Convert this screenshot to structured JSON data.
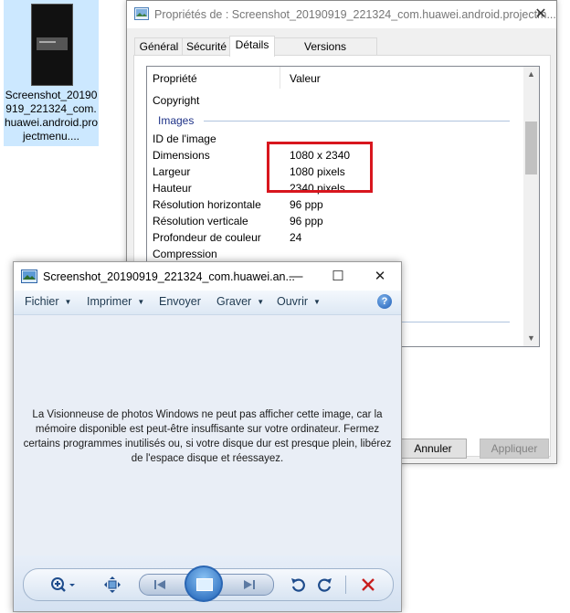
{
  "desktop_file": {
    "name": "Screenshot_20190919_221324_com.huawei.android.projectmenu...."
  },
  "properties_window": {
    "title": "Propriétés de : Screenshot_20190919_221324_com.huawei.android.projectm...",
    "close_glyph": "✕",
    "tabs": [
      "Général",
      "Sécurité",
      "Détails",
      "Versions précédentes"
    ],
    "active_tab": "Détails",
    "columns": {
      "property": "Propriété",
      "value": "Valeur"
    },
    "section_images": "Images",
    "rows": [
      {
        "label": "Copyright",
        "value": ""
      },
      {
        "label": "ID de l'image",
        "value": ""
      },
      {
        "label": "Dimensions",
        "value": "1080 x 2340"
      },
      {
        "label": "Largeur",
        "value": "1080 pixels"
      },
      {
        "label": "Hauteur",
        "value": "2340 pixels"
      },
      {
        "label": "Résolution horizontale",
        "value": "96 ppp"
      },
      {
        "label": "Résolution verticale",
        "value": "96 ppp"
      },
      {
        "label": "Profondeur de couleur",
        "value": "24"
      },
      {
        "label": "Compression",
        "value": ""
      }
    ],
    "highlight_color": "#d8161e",
    "buttons": {
      "cancel": "Annuler",
      "apply": "Appliquer"
    }
  },
  "viewer_window": {
    "title": "Screenshot_20190919_221324_com.huawei.an...",
    "window_controls": {
      "minimize": "—",
      "maximize": "☐",
      "close": "✕"
    },
    "menu": [
      {
        "label": "Fichier",
        "arrow": "▼"
      },
      {
        "label": "Imprimer",
        "arrow": "▼"
      },
      {
        "label": "Envoyer",
        "arrow": ""
      },
      {
        "label": "Graver",
        "arrow": "▼"
      },
      {
        "label": "Ouvrir",
        "arrow": "▼"
      }
    ],
    "help_glyph": "?",
    "message": "La Visionneuse de photos Windows ne peut pas afficher cette image, car la mémoire disponible est peut-être insuffisante sur votre ordinateur. Fermez certains programmes inutilisés ou, si votre disque dur est presque plein, libérez de l'espace disque et réessayez.",
    "toolbar_icons": [
      "zoom-icon",
      "fit-window-icon",
      "previous-icon",
      "slideshow-icon",
      "next-icon",
      "rotate-left-icon",
      "rotate-right-icon",
      "delete-icon"
    ],
    "delete_color": "#c81e1e"
  }
}
